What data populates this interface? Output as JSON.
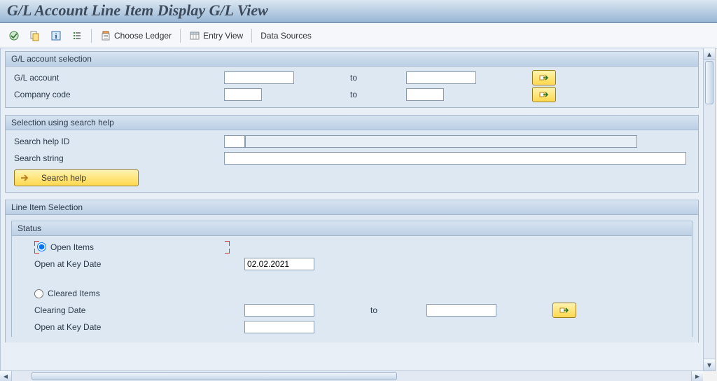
{
  "title": "G/L Account Line Item Display G/L View",
  "toolbar": {
    "choose_ledger": "Choose Ledger",
    "entry_view": "Entry View",
    "data_sources": "Data Sources"
  },
  "labels": {
    "to": "to"
  },
  "group1": {
    "title": "G/L account selection",
    "gl_account_label": "G/L account",
    "gl_account_from": "",
    "gl_account_to": "",
    "company_code_label": "Company code",
    "company_code_from": "",
    "company_code_to": ""
  },
  "group2": {
    "title": "Selection using search help",
    "search_help_id_label": "Search help ID",
    "search_help_id_flag": "",
    "search_help_id_value": "",
    "search_string_label": "Search string",
    "search_string_value": "",
    "search_help_button": "Search help"
  },
  "group3": {
    "title": "Line Item Selection",
    "status": {
      "title": "Status",
      "open_items_label": "Open Items",
      "open_key_date_label": "Open at Key Date",
      "open_key_date_value": "02.02.2021",
      "cleared_items_label": "Cleared Items",
      "clearing_date_label": "Clearing Date",
      "clearing_date_from": "",
      "clearing_date_to": "",
      "cleared_key_date_label": "Open at Key Date",
      "cleared_key_date_value": ""
    }
  }
}
